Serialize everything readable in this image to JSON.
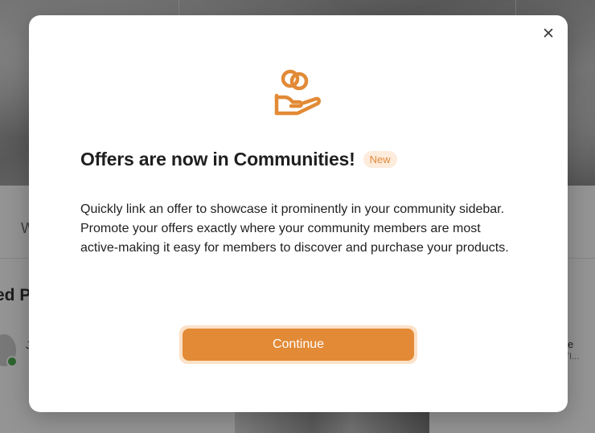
{
  "background": {
    "tab_fragment": "W",
    "section_title_fragment": "ed P",
    "author_fragment": "J",
    "right_fragment": "e",
    "right_sub_fragment": "STI..."
  },
  "modal": {
    "icon": "hand-holding-coins-icon",
    "title": "Offers are now in Communities!",
    "badge": "New",
    "description": "Quickly link an offer to showcase it prominently in your community sidebar. Promote your offers exactly where your community members are most active-making it easy for members to discover and purchase your products.",
    "continue_label": "Continue",
    "close_icon": "close-icon"
  },
  "colors": {
    "accent": "#e28a36",
    "badge_bg": "#fdebdc",
    "badge_text": "#e08a3a",
    "text": "#1f1f1f"
  }
}
